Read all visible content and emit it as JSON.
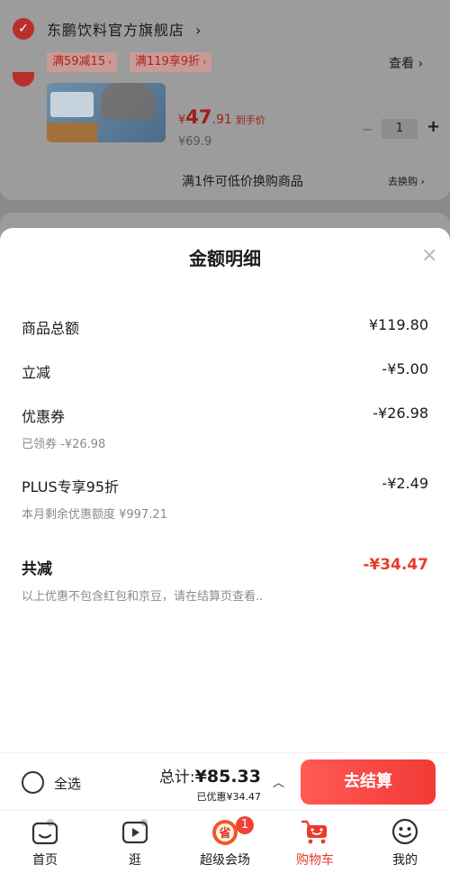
{
  "store": {
    "name": "东鹏饮料官方旗舰店",
    "chevron": "›",
    "promos": [
      {
        "label": "满59减15"
      },
      {
        "label": "满119享9折"
      }
    ],
    "view_link": "查看 ›"
  },
  "product": {
    "price_yen": "¥",
    "price_int": "47",
    "price_dec": ".91",
    "price_tag": "到手价",
    "orig_price": "¥69.9",
    "quantity": "1",
    "minus": "−",
    "plus": "+",
    "swap_text": "满1件可低价换购商品",
    "swap_link": "去换购 ›"
  },
  "sheet": {
    "title": "金额明细",
    "close": "×",
    "rows": {
      "goods_total": {
        "label": "商品总额",
        "value": "¥119.80"
      },
      "instant": {
        "label": "立减",
        "value": "-¥5.00"
      },
      "coupon": {
        "label": "优惠券",
        "value": "-¥26.98",
        "sub": "已领券 -¥26.98"
      },
      "plus": {
        "label": "PLUS专享95折",
        "value": "-¥2.49",
        "sub": "本月剩余优惠额度 ¥997.21"
      }
    },
    "total_reduce": {
      "label": "共减",
      "value": "-¥34.47"
    },
    "note": "以上优惠不包含红包和京豆，请在结算页查看.."
  },
  "checkout": {
    "select_all": "全选",
    "total_label": "总计:",
    "total_amount": "¥85.33",
    "discount": "已优惠¥34.47",
    "chevron_up": "︿",
    "button": "去结算"
  },
  "tabbar": {
    "tabs": [
      {
        "label": "首页",
        "icon": "home-icon"
      },
      {
        "label": "逛",
        "icon": "play-icon"
      },
      {
        "label": "超级会场",
        "icon": "venue-icon",
        "badge": "1"
      },
      {
        "label": "购物车",
        "icon": "cart-icon",
        "active": true
      },
      {
        "label": "我的",
        "icon": "smile-icon"
      }
    ]
  },
  "colors": {
    "accent": "#e93b2b",
    "checkout_button": "#f23a36",
    "overlay": "#7b7b7b"
  }
}
